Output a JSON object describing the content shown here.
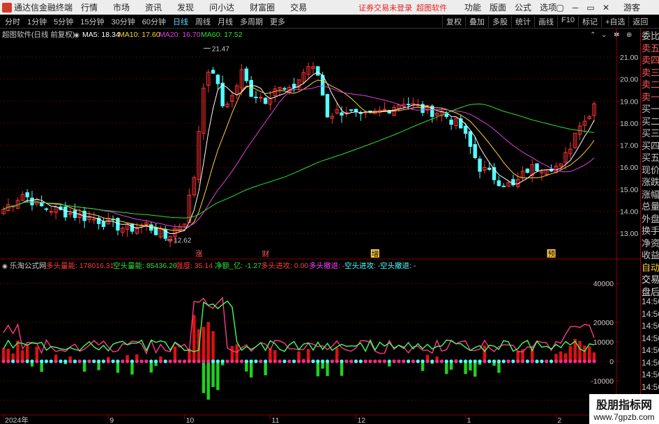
{
  "titlebar": {
    "app_name": "通达信金融终端",
    "menu": [
      "行情",
      "市场",
      "资讯",
      "发现",
      "问小达",
      "财富圈",
      "交易"
    ],
    "notice": "证券交易未登录",
    "notice2": "超图软件",
    "right_menu": [
      "功能",
      "版面",
      "公式",
      "选项"
    ],
    "window_controls": [
      "▢",
      "─",
      "▭",
      "✕"
    ],
    "guest": "游客"
  },
  "toolbar": {
    "periods": [
      "分时",
      "1分钟",
      "5分钟",
      "15分钟",
      "30分钟",
      "60分钟",
      "日线",
      "周线",
      "月线",
      "多周期",
      "更多"
    ],
    "active_period": "日线",
    "tools": [
      "复权",
      "叠加",
      "多股",
      "统计",
      "画线",
      "F10",
      "标记",
      "+自选",
      "返回"
    ]
  },
  "infobar": {
    "stock": "超图软件(日线 前复权)",
    "ma5": "MA5: 18.34",
    "ma10": "MA10: 17.60",
    "ma20": "MA20: 16.70",
    "ma60": "MA60: 17.52"
  },
  "colors": {
    "up": "#ff3333",
    "down": "#54ffff",
    "ma5": "#ffffff",
    "ma10": "#ffd23a",
    "ma20": "#e040e0",
    "ma60": "#30e030",
    "grid": "#7a0000"
  },
  "price_axis": [
    "21.00",
    "20.00",
    "19.00",
    "18.00",
    "17.00",
    "16.00",
    "15.00",
    "14.00",
    "13.00"
  ],
  "price_marks": {
    "high": "21.47",
    "low": "12.62"
  },
  "event_marks": [
    "涨",
    "财",
    "增",
    "预"
  ],
  "indicator": {
    "name": "乐淘公式网",
    "long_energy": "多头量能: 178016.31",
    "short_energy": "空头量能: 85436.26",
    "strength": "强度: 35.14",
    "net": "净额_亿: -1.27",
    "long_in": "多头进攻: 0.00",
    "long_out": "多头撤退: -",
    "short_in": "空头进攻: -",
    "short_out": "空头撤退: -",
    "axis": [
      "40000",
      "20000",
      "10000",
      "0",
      "-10000",
      "-20000"
    ]
  },
  "date_axis": [
    "2024年",
    "9",
    "10",
    "11",
    "12",
    "1",
    "2"
  ],
  "sidebar": {
    "quote_items": [
      "委比",
      "卖五",
      "卖四",
      "卖三",
      "卖二",
      "卖一",
      "买一",
      "买二",
      "买三",
      "买四",
      "买五",
      "现价",
      "涨跌",
      "涨幅",
      "总量",
      "外盘",
      "换手",
      "净资",
      "收益"
    ],
    "auto": "自动",
    "trade_items": [
      "交易",
      "盘后"
    ],
    "times": [
      "14:56",
      "14:56",
      "14:56",
      "14:56",
      "14:56",
      "14:56",
      "14:56",
      "14:56",
      "14:56"
    ]
  },
  "watermark": {
    "line1": "股朋指标网",
    "line2": "www.7gpzb.com"
  }
}
